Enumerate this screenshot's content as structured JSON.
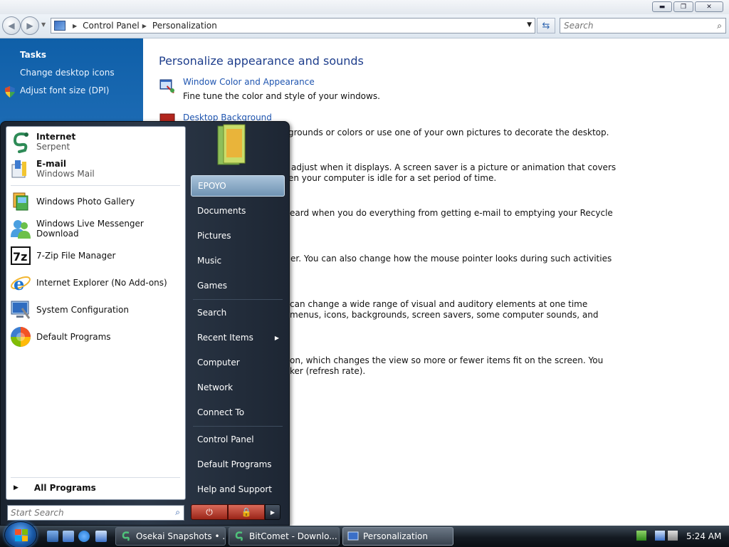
{
  "window": {
    "breadcrumb": [
      "Control Panel",
      "Personalization"
    ],
    "search_placeholder": "Search"
  },
  "tasks": {
    "title": "Tasks",
    "links": [
      "Change desktop icons",
      "Adjust font size (DPI)"
    ]
  },
  "content": {
    "heading": "Personalize appearance and sounds",
    "items": [
      {
        "link": "Window Color and Appearance",
        "desc": "Fine tune the color and style of your windows."
      },
      {
        "link": "Desktop Background"
      }
    ],
    "visible_fragments": [
      "grounds or colors or use one of your own pictures to decorate the desktop.",
      "adjust when it displays. A screen saver is a picture or animation that covers",
      "en your computer is idle for a set period of time.",
      "eard when you do everything from getting e-mail to emptying your Recycle",
      "er. You can also change how the mouse pointer looks during such activities",
      "can change a wide range of visual and auditory elements at one time",
      "menus, icons, backgrounds, screen savers, some computer sounds, and",
      "on, which changes the view so more or fewer items fit on the screen. You",
      "ker (refresh rate)."
    ]
  },
  "start_menu": {
    "pinned": [
      {
        "title": "Internet",
        "subtitle": "Serpent"
      },
      {
        "title": "E-mail",
        "subtitle": "Windows Mail"
      }
    ],
    "recent": [
      "Windows Photo Gallery",
      "Windows Live Messenger Download",
      "7-Zip File Manager",
      "Internet Explorer (No Add-ons)",
      "System Configuration",
      "Default Programs"
    ],
    "all_programs": "All Programs",
    "search_placeholder": "Start Search",
    "right_items": {
      "user": "EPOYO",
      "documents": "Documents",
      "pictures": "Pictures",
      "music": "Music",
      "games": "Games",
      "search": "Search",
      "recent_items": "Recent Items",
      "computer": "Computer",
      "network": "Network",
      "connect_to": "Connect To",
      "control_panel": "Control Panel",
      "default_programs": "Default Programs",
      "help_support": "Help and Support"
    }
  },
  "taskbar": {
    "buttons": [
      "Osekai Snapshots • ...",
      "BitComet - Downlo...",
      "Personalization"
    ],
    "clock": "5:24 AM"
  },
  "colors": {
    "link": "#1f55b0",
    "heading": "#1e3e8c",
    "task_pane": "#2c79c2",
    "start_menu_dark": "#1b2430",
    "power_red": "#9a2518"
  }
}
